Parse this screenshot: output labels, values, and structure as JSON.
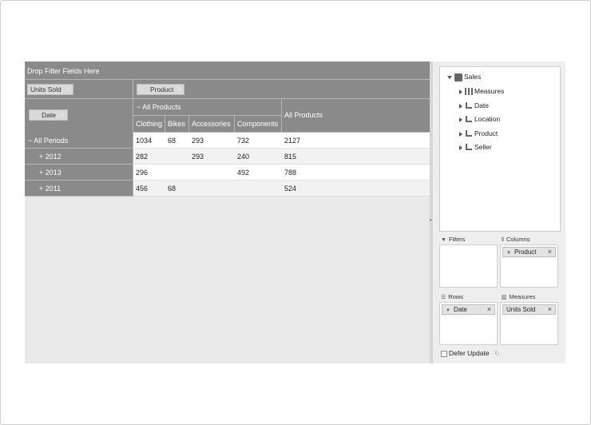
{
  "grid": {
    "filter_zone_label": "Drop Filter Fields Here",
    "data_field": {
      "label": "Units Sold",
      "remove": "×"
    },
    "column_field": {
      "label": "Product",
      "remove": "×"
    },
    "row_field": {
      "label": "Date",
      "remove": "×"
    },
    "column_headers": {
      "expand_symbol": "−",
      "all_products": "All Products",
      "grand_total": "All Products",
      "leaves": [
        "Clothing",
        "Bikes",
        "Accessories",
        "Components"
      ]
    },
    "rows": [
      {
        "symbol": "−",
        "label": "All Periods",
        "values": [
          "1034",
          "68",
          "293",
          "732",
          "2127"
        ]
      },
      {
        "symbol": "+",
        "label": "2012",
        "values": [
          "282",
          "",
          "293",
          "240",
          "815"
        ]
      },
      {
        "symbol": "+",
        "label": "2013",
        "values": [
          "296",
          "",
          "",
          "492",
          "788"
        ]
      },
      {
        "symbol": "+",
        "label": "2011",
        "values": [
          "456",
          "68",
          "",
          "",
          "524"
        ]
      }
    ]
  },
  "field_list": {
    "root": "Sales",
    "nodes": [
      "Measures",
      "Date",
      "Location",
      "Product",
      "Seller"
    ],
    "areas": {
      "filters": {
        "label": "Filters",
        "icon": "filter-icon",
        "chips": []
      },
      "columns": {
        "label": "Columns",
        "icon": "columns-icon",
        "chips": [
          {
            "label": "Product",
            "remove": "×"
          }
        ]
      },
      "rows": {
        "label": "Rows",
        "icon": "rows-icon",
        "chips": [
          {
            "label": "Date",
            "remove": "×"
          }
        ]
      },
      "measures": {
        "label": "Measures",
        "icon": "measures-icon",
        "chips": [
          {
            "label": "Units Sold",
            "remove": "×"
          }
        ]
      }
    },
    "defer_update_label": "Defer Update",
    "defer_update_checked": false
  }
}
